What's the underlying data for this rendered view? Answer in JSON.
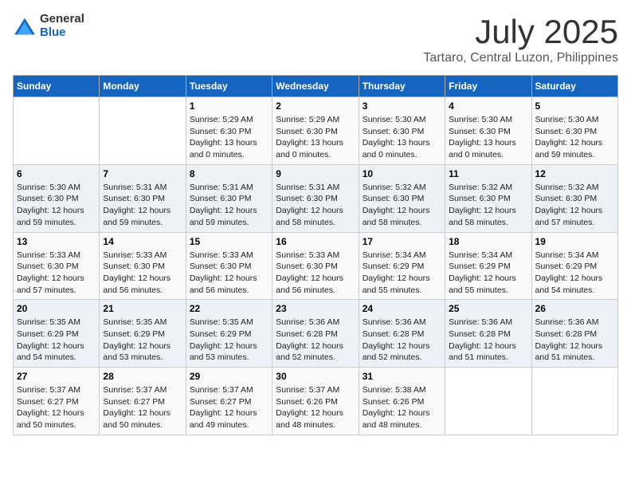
{
  "header": {
    "logo_general": "General",
    "logo_blue": "Blue",
    "month": "July 2025",
    "location": "Tartaro, Central Luzon, Philippines"
  },
  "days_of_week": [
    "Sunday",
    "Monday",
    "Tuesday",
    "Wednesday",
    "Thursday",
    "Friday",
    "Saturday"
  ],
  "weeks": [
    [
      {
        "day": "",
        "info": ""
      },
      {
        "day": "",
        "info": ""
      },
      {
        "day": "1",
        "info": "Sunrise: 5:29 AM\nSunset: 6:30 PM\nDaylight: 13 hours and 0 minutes."
      },
      {
        "day": "2",
        "info": "Sunrise: 5:29 AM\nSunset: 6:30 PM\nDaylight: 13 hours and 0 minutes."
      },
      {
        "day": "3",
        "info": "Sunrise: 5:30 AM\nSunset: 6:30 PM\nDaylight: 13 hours and 0 minutes."
      },
      {
        "day": "4",
        "info": "Sunrise: 5:30 AM\nSunset: 6:30 PM\nDaylight: 13 hours and 0 minutes."
      },
      {
        "day": "5",
        "info": "Sunrise: 5:30 AM\nSunset: 6:30 PM\nDaylight: 12 hours and 59 minutes."
      }
    ],
    [
      {
        "day": "6",
        "info": "Sunrise: 5:30 AM\nSunset: 6:30 PM\nDaylight: 12 hours and 59 minutes."
      },
      {
        "day": "7",
        "info": "Sunrise: 5:31 AM\nSunset: 6:30 PM\nDaylight: 12 hours and 59 minutes."
      },
      {
        "day": "8",
        "info": "Sunrise: 5:31 AM\nSunset: 6:30 PM\nDaylight: 12 hours and 59 minutes."
      },
      {
        "day": "9",
        "info": "Sunrise: 5:31 AM\nSunset: 6:30 PM\nDaylight: 12 hours and 58 minutes."
      },
      {
        "day": "10",
        "info": "Sunrise: 5:32 AM\nSunset: 6:30 PM\nDaylight: 12 hours and 58 minutes."
      },
      {
        "day": "11",
        "info": "Sunrise: 5:32 AM\nSunset: 6:30 PM\nDaylight: 12 hours and 58 minutes."
      },
      {
        "day": "12",
        "info": "Sunrise: 5:32 AM\nSunset: 6:30 PM\nDaylight: 12 hours and 57 minutes."
      }
    ],
    [
      {
        "day": "13",
        "info": "Sunrise: 5:33 AM\nSunset: 6:30 PM\nDaylight: 12 hours and 57 minutes."
      },
      {
        "day": "14",
        "info": "Sunrise: 5:33 AM\nSunset: 6:30 PM\nDaylight: 12 hours and 56 minutes."
      },
      {
        "day": "15",
        "info": "Sunrise: 5:33 AM\nSunset: 6:30 PM\nDaylight: 12 hours and 56 minutes."
      },
      {
        "day": "16",
        "info": "Sunrise: 5:33 AM\nSunset: 6:30 PM\nDaylight: 12 hours and 56 minutes."
      },
      {
        "day": "17",
        "info": "Sunrise: 5:34 AM\nSunset: 6:29 PM\nDaylight: 12 hours and 55 minutes."
      },
      {
        "day": "18",
        "info": "Sunrise: 5:34 AM\nSunset: 6:29 PM\nDaylight: 12 hours and 55 minutes."
      },
      {
        "day": "19",
        "info": "Sunrise: 5:34 AM\nSunset: 6:29 PM\nDaylight: 12 hours and 54 minutes."
      }
    ],
    [
      {
        "day": "20",
        "info": "Sunrise: 5:35 AM\nSunset: 6:29 PM\nDaylight: 12 hours and 54 minutes."
      },
      {
        "day": "21",
        "info": "Sunrise: 5:35 AM\nSunset: 6:29 PM\nDaylight: 12 hours and 53 minutes."
      },
      {
        "day": "22",
        "info": "Sunrise: 5:35 AM\nSunset: 6:29 PM\nDaylight: 12 hours and 53 minutes."
      },
      {
        "day": "23",
        "info": "Sunrise: 5:36 AM\nSunset: 6:28 PM\nDaylight: 12 hours and 52 minutes."
      },
      {
        "day": "24",
        "info": "Sunrise: 5:36 AM\nSunset: 6:28 PM\nDaylight: 12 hours and 52 minutes."
      },
      {
        "day": "25",
        "info": "Sunrise: 5:36 AM\nSunset: 6:28 PM\nDaylight: 12 hours and 51 minutes."
      },
      {
        "day": "26",
        "info": "Sunrise: 5:36 AM\nSunset: 6:28 PM\nDaylight: 12 hours and 51 minutes."
      }
    ],
    [
      {
        "day": "27",
        "info": "Sunrise: 5:37 AM\nSunset: 6:27 PM\nDaylight: 12 hours and 50 minutes."
      },
      {
        "day": "28",
        "info": "Sunrise: 5:37 AM\nSunset: 6:27 PM\nDaylight: 12 hours and 50 minutes."
      },
      {
        "day": "29",
        "info": "Sunrise: 5:37 AM\nSunset: 6:27 PM\nDaylight: 12 hours and 49 minutes."
      },
      {
        "day": "30",
        "info": "Sunrise: 5:37 AM\nSunset: 6:26 PM\nDaylight: 12 hours and 48 minutes."
      },
      {
        "day": "31",
        "info": "Sunrise: 5:38 AM\nSunset: 6:26 PM\nDaylight: 12 hours and 48 minutes."
      },
      {
        "day": "",
        "info": ""
      },
      {
        "day": "",
        "info": ""
      }
    ]
  ]
}
